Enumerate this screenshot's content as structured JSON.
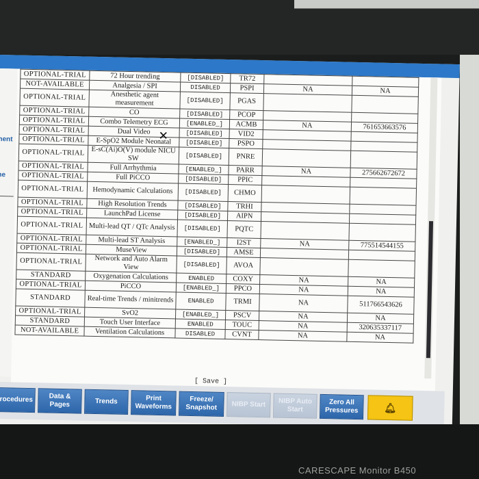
{
  "left_labels": [
    "nent",
    "ne"
  ],
  "columns": [
    "license_type",
    "option",
    "status",
    "code",
    "field_a",
    "field_b"
  ],
  "rows": [
    {
      "type": "OPTIONAL-TRIAL",
      "option": "72 Hour trending",
      "status": "[DISABLED]",
      "code": "TR72",
      "a": "",
      "b": ""
    },
    {
      "type": "NOT-AVAILABLE",
      "option": "Analgesia / SPI",
      "status": "DISABLED",
      "code": "PSPI",
      "a": "NA",
      "b": "NA"
    },
    {
      "type": "OPTIONAL-TRIAL",
      "option": "Anesthetic agent measurement",
      "status": "[DISABLED]",
      "code": "PGAS",
      "a": "",
      "b": ""
    },
    {
      "type": "OPTIONAL-TRIAL",
      "option": "CO",
      "status": "[DISABLED]",
      "code": "PCOP",
      "a": "",
      "b": ""
    },
    {
      "type": "OPTIONAL-TRIAL",
      "option": "Combo Telemetry ECG",
      "status": "[ENABLED_]",
      "code": "ACMB",
      "a": "NA",
      "b": "761653663576"
    },
    {
      "type": "OPTIONAL-TRIAL",
      "option": "Dual Video",
      "status": "[DISABLED]",
      "code": "VID2",
      "a": "",
      "b": ""
    },
    {
      "type": "OPTIONAL-TRIAL",
      "option": "E-SpO2 Module Neonatal",
      "status": "[DISABLED]",
      "code": "PSPO",
      "a": "",
      "b": ""
    },
    {
      "type": "OPTIONAL-TRIAL",
      "option": "E-sC(Ai)O(V) module NICU SW",
      "status": "[DISABLED]",
      "code": "PNRE",
      "a": "",
      "b": ""
    },
    {
      "type": "OPTIONAL-TRIAL",
      "option": "Full Arrhythmia",
      "status": "[ENABLED_]",
      "code": "PARR",
      "a": "NA",
      "b": "275662672672"
    },
    {
      "type": "OPTIONAL-TRIAL",
      "option": "Full PiCCO",
      "status": "[DISABLED]",
      "code": "PPIC",
      "a": "",
      "b": ""
    },
    {
      "type": "OPTIONAL-TRIAL",
      "option": "Hemodynamic Calculations",
      "status": "[DISABLED]",
      "code": "CHMO",
      "a": "",
      "b": ""
    },
    {
      "type": "OPTIONAL-TRIAL",
      "option": "High Resolution Trends",
      "status": "[DISABLED]",
      "code": "TRHI",
      "a": "",
      "b": ""
    },
    {
      "type": "OPTIONAL-TRIAL",
      "option": "LaunchPad License",
      "status": "[DISABLED]",
      "code": "AIPN",
      "a": "",
      "b": ""
    },
    {
      "type": "OPTIONAL-TRIAL",
      "option": "Multi-lead QT / QTc Analysis",
      "status": "[DISABLED]",
      "code": "PQTC",
      "a": "",
      "b": ""
    },
    {
      "type": "OPTIONAL-TRIAL",
      "option": "Multi-lead ST Analysis",
      "status": "[ENABLED_]",
      "code": "I2ST",
      "a": "NA",
      "b": "775514544155"
    },
    {
      "type": "OPTIONAL-TRIAL",
      "option": "MuseView",
      "status": "[DISABLED]",
      "code": "AMSE",
      "a": "",
      "b": ""
    },
    {
      "type": "OPTIONAL-TRIAL",
      "option": "Network and Auto Alarm View",
      "status": "[DISABLED]",
      "code": "AVOA",
      "a": "",
      "b": ""
    },
    {
      "type": "STANDARD",
      "option": "Oxygenation Calculations",
      "status": "ENABLED",
      "code": "COXY",
      "a": "NA",
      "b": "NA"
    },
    {
      "type": "OPTIONAL-TRIAL",
      "option": "PiCCO",
      "status": "[ENABLED_]",
      "code": "PPCO",
      "a": "NA",
      "b": "NA"
    },
    {
      "type": "STANDARD",
      "option": "Real-time Trends / minitrends",
      "status": "ENABLED",
      "code": "TRMI",
      "a": "NA",
      "b": "511766543626"
    },
    {
      "type": "OPTIONAL-TRIAL",
      "option": "SvO2",
      "status": "[ENABLED_]",
      "code": "PSCV",
      "a": "NA",
      "b": "NA"
    },
    {
      "type": "STANDARD",
      "option": "Touch User Interface",
      "status": "ENABLED",
      "code": "TOUC",
      "a": "NA",
      "b": "320635337117"
    },
    {
      "type": "NOT-AVAILABLE",
      "option": "Ventilation Calculations",
      "status": "DISABLED",
      "code": "CVNT",
      "a": "NA",
      "b": "NA"
    }
  ],
  "save_label": "[ Save ]",
  "toolbar": {
    "procedures": "Procedures",
    "data_pages": "Data & Pages",
    "trends": "Trends",
    "print_waveforms": "Print Waveforms",
    "freeze_snapshot": "Freeze/ Snapshot",
    "nibp_start": "NIBP Start",
    "nibp_auto": "NIBP Auto Start",
    "zero_all": "Zero All Pressures",
    "alarm_icon": "bell-icon"
  },
  "brand": "CARESCAPE Monitor B450"
}
